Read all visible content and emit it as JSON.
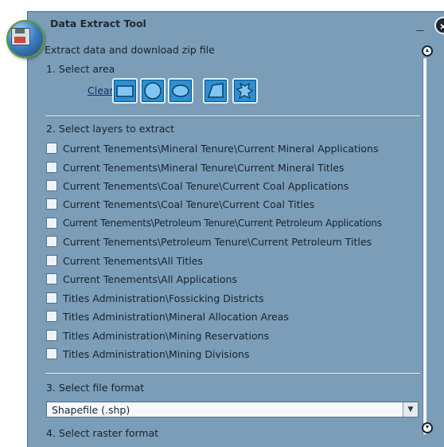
{
  "window": {
    "title": "Data Extract Tool",
    "minimize_label": "_",
    "close_label": "×",
    "logo_icon": "globe-floppy-icon"
  },
  "intro": "Extract data and download zip file",
  "step1": {
    "label": "1. Select area",
    "clear_label": "Clear",
    "tools": [
      {
        "name": "rectangle-tool",
        "icon": "rectangle-icon"
      },
      {
        "name": "circle-tool",
        "icon": "circle-icon"
      },
      {
        "name": "ellipse-tool",
        "icon": "ellipse-icon"
      },
      {
        "name": "polygon-tool",
        "icon": "polygon-icon"
      },
      {
        "name": "freehand-tool",
        "icon": "freehand-icon"
      }
    ]
  },
  "step2": {
    "label": "2. Select layers to extract",
    "layers": [
      "Current Tenements\\Mineral Tenure\\Current Mineral Applications",
      "Current Tenements\\Mineral Tenure\\Current Mineral Titles",
      "Current Tenements\\Coal Tenure\\Current Coal Applications",
      "Current Tenements\\Coal Tenure\\Current Coal Titles",
      "Current Tenements\\Petroleum Tenure\\Current Petroleum Applications",
      "Current Tenements\\Petroleum Tenure\\Current Petroleum Titles",
      "Current Tenements\\All Titles",
      "Current Tenements\\All Applications",
      "Titles Administration\\Fossicking Districts",
      "Titles Administration\\Mineral Allocation Areas",
      "Titles Administration\\Mining Reservations",
      "Titles Administration\\Mining Divisions"
    ]
  },
  "step3": {
    "label": "3. Select file format",
    "selected": "Shapefile (.shp)"
  },
  "step4": {
    "label": "4. Select raster format"
  },
  "colors": {
    "panel": "#7b9db8",
    "tool_button": "#2b8fd1",
    "text": "#17232e"
  }
}
